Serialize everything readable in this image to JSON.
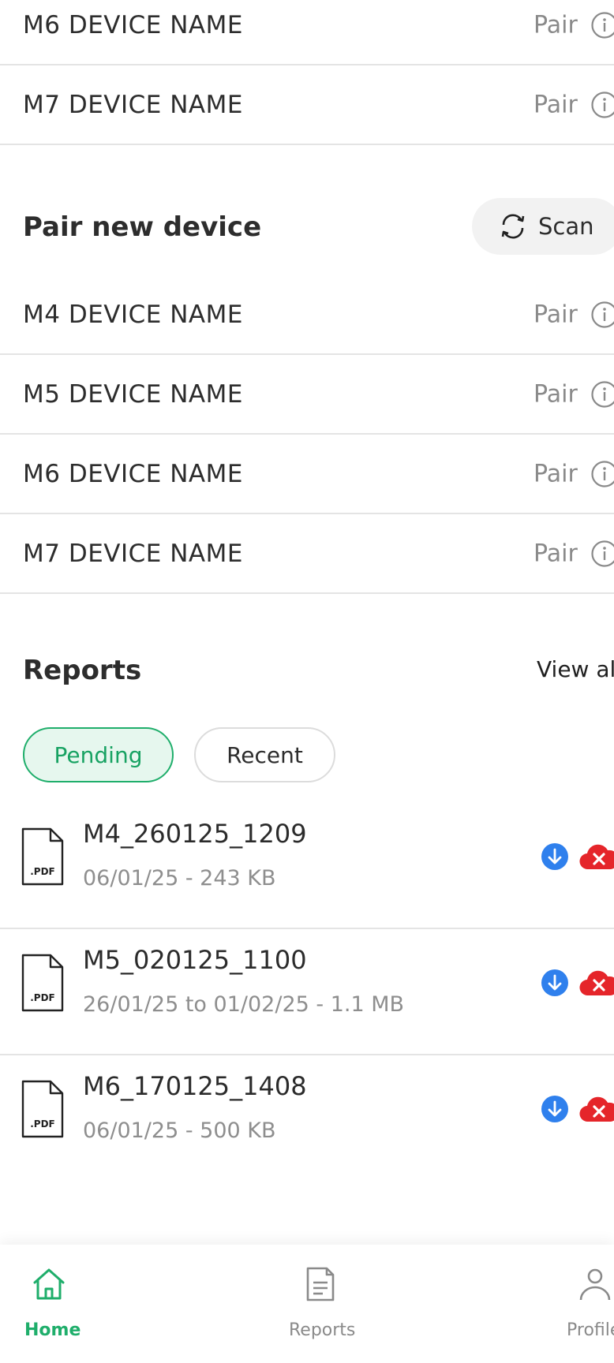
{
  "paired_devices": [
    {
      "name": "M6 DEVICE NAME",
      "action": "Pair"
    },
    {
      "name": "M7 DEVICE NAME",
      "action": "Pair"
    }
  ],
  "pair_new": {
    "title": "Pair new device",
    "scan_label": "Scan",
    "devices": [
      {
        "name": "M4 DEVICE NAME",
        "action": "Pair"
      },
      {
        "name": "M5 DEVICE NAME",
        "action": "Pair"
      },
      {
        "name": "M6 DEVICE NAME",
        "action": "Pair"
      },
      {
        "name": "M7 DEVICE NAME",
        "action": "Pair"
      }
    ]
  },
  "reports": {
    "title": "Reports",
    "view_all": "View all",
    "tabs": [
      {
        "label": "Pending",
        "selected": true
      },
      {
        "label": "Recent",
        "selected": false
      }
    ],
    "items": [
      {
        "name": "M4_260125_1209",
        "meta": "06/01/25 - 243 KB",
        "file_type": ".PDF"
      },
      {
        "name": "M5_020125_1100",
        "meta": "26/01/25 to 01/02/25 - 1.1 MB",
        "file_type": ".PDF"
      },
      {
        "name": "M6_170125_1408",
        "meta": "06/01/25 - 500 KB",
        "file_type": ".PDF"
      }
    ]
  },
  "bottom_nav": {
    "items": [
      {
        "label": "Home",
        "icon": "home-icon",
        "active": true
      },
      {
        "label": "Reports",
        "icon": "document-icon",
        "active": false
      },
      {
        "label": "Profile",
        "icon": "person-icon",
        "active": false
      }
    ]
  },
  "colors": {
    "accent": "#1fae6b",
    "accent_bg": "#e6f7ee",
    "download_blue": "#2f80ed",
    "delete_red": "#e5252a",
    "muted_text": "#8a8a8a"
  }
}
